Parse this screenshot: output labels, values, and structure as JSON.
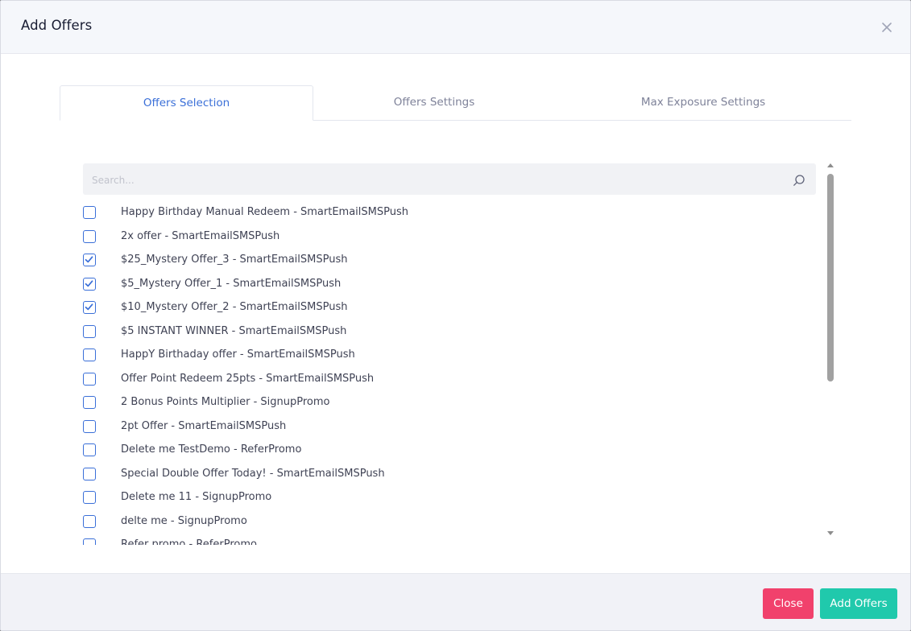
{
  "modal": {
    "title": "Add Offers",
    "close_icon": "close-icon"
  },
  "tabs": [
    {
      "label": "Offers Selection",
      "active": true
    },
    {
      "label": "Offers Settings",
      "active": false
    },
    {
      "label": "Max Exposure Settings",
      "active": false
    }
  ],
  "search": {
    "placeholder": "Search...",
    "value": "",
    "icon": "search-icon"
  },
  "offers": [
    {
      "label": "Happy Birthday Manual Redeem - SmartEmailSMSPush",
      "checked": false
    },
    {
      "label": "2x offer - SmartEmailSMSPush",
      "checked": false
    },
    {
      "label": "$25_Mystery Offer_3 - SmartEmailSMSPush",
      "checked": true
    },
    {
      "label": "$5_Mystery Offer_1 - SmartEmailSMSPush",
      "checked": true
    },
    {
      "label": "$10_Mystery Offer_2 - SmartEmailSMSPush",
      "checked": true
    },
    {
      "label": "$5 INSTANT WINNER - SmartEmailSMSPush",
      "checked": false
    },
    {
      "label": "HappY Birthaday offer - SmartEmailSMSPush",
      "checked": false
    },
    {
      "label": "Offer Point Redeem 25pts - SmartEmailSMSPush",
      "checked": false
    },
    {
      "label": "2 Bonus Points Multiplier - SignupPromo",
      "checked": false
    },
    {
      "label": "2pt Offer - SmartEmailSMSPush",
      "checked": false
    },
    {
      "label": "Delete me TestDemo - ReferPromo",
      "checked": false
    },
    {
      "label": "Special Double Offer Today! - SmartEmailSMSPush",
      "checked": false
    },
    {
      "label": "Delete me 11 - SignupPromo",
      "checked": false
    },
    {
      "label": "delte me - SignupPromo",
      "checked": false
    },
    {
      "label": "Refer promo - ReferPromo",
      "checked": false
    }
  ],
  "footer": {
    "close_label": "Close",
    "add_label": "Add Offers"
  },
  "colors": {
    "accent": "#3a6fd8",
    "close_button": "#f1416c",
    "add_button": "#20c9ac"
  }
}
